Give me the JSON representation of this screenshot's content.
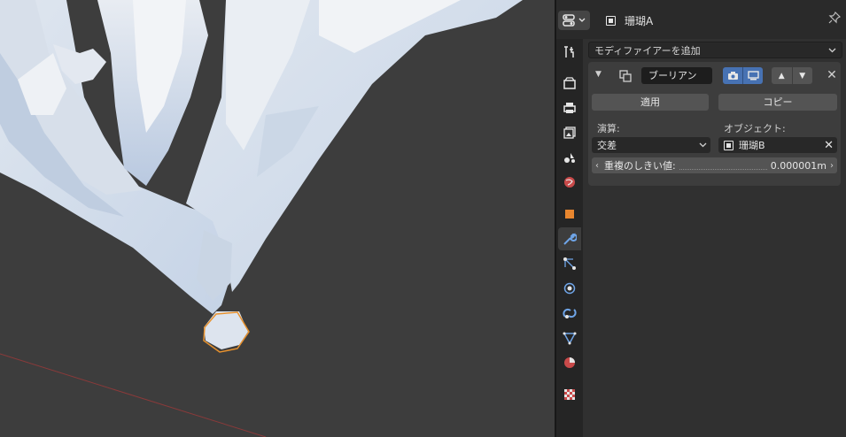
{
  "header": {
    "object_name": "珊瑚A",
    "editor_type_icon": "properties-editor-icon",
    "pin_icon": "pin-icon"
  },
  "tabs": [
    {
      "name": "tool-tab",
      "icon": "tool-icon"
    },
    {
      "name": "render-tab",
      "icon": "render-icon"
    },
    {
      "name": "output-tab",
      "icon": "output-icon"
    },
    {
      "name": "view-layer-tab",
      "icon": "view-layer-icon"
    },
    {
      "name": "scene-tab",
      "icon": "scene-icon"
    },
    {
      "name": "world-tab",
      "icon": "world-icon"
    },
    {
      "name": "object-tab",
      "icon": "object-icon"
    },
    {
      "name": "modifier-tab",
      "icon": "wrench-icon",
      "active": true
    },
    {
      "name": "particles-tab",
      "icon": "particles-icon"
    },
    {
      "name": "physics-tab",
      "icon": "physics-icon"
    },
    {
      "name": "constraints-tab",
      "icon": "constraints-icon"
    },
    {
      "name": "data-tab",
      "icon": "mesh-data-icon"
    },
    {
      "name": "material-tab",
      "icon": "material-icon"
    },
    {
      "name": "texture-tab",
      "icon": "texture-icon"
    }
  ],
  "modifiers": {
    "add_label": "モディファイアーを追加",
    "boolean": {
      "name": "ブーリアン",
      "apply_label": "適用",
      "copy_label": "コピー",
      "operation_label": "演算:",
      "operation_value": "交差",
      "object_label": "オブジェクト:",
      "object_value": "珊瑚B",
      "overlap_label": "重複のしきい値:",
      "overlap_value": "0.000001m"
    }
  },
  "colors": {
    "accent_blue": "#4772b3",
    "selection_orange": "#e8922e",
    "active_tab": "#3d3d3d"
  }
}
